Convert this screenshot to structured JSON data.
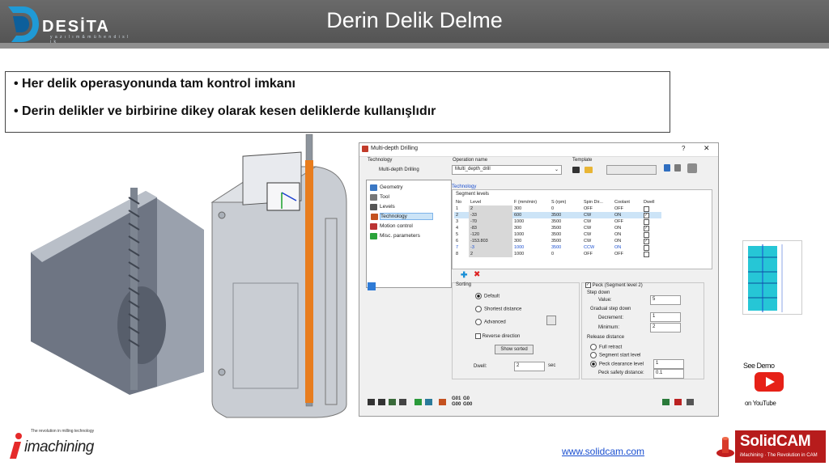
{
  "header": {
    "title": "Derin Delik Delme",
    "logo_name": "DESİTA",
    "logo_tagline": "y a z ı l ı m   &   m ü h e n d i s l i k"
  },
  "bullets": [
    "Her delik operasyonunda tam kontrol imkanı",
    "Derin delikler ve birbirine dikey olarak kesen deliklerde kullanışlıdır"
  ],
  "dialog": {
    "title": "Multi-depth Drilling",
    "technology_label": "Technology",
    "technology_value": "Multi-depth Drilling",
    "operation_name_label": "Operation name",
    "operation_name_value": "Multi_depth_drill",
    "template_label": "Template",
    "tab_label": "Technology",
    "tree_items": [
      "Geometry",
      "Tool",
      "Levels",
      "Technology",
      "Motion control",
      "Misc. parameters"
    ],
    "segment_levels_label": "Segment levels",
    "columns": [
      "No",
      "Level",
      "F (mm/min)",
      "S (rpm)",
      "Spin Dir...",
      "Coolant",
      "Dwell"
    ],
    "rows": [
      {
        "no": "1",
        "level": "2",
        "f": "300",
        "s": "0",
        "spin": "OFF",
        "coolant": "OFF",
        "dwell": false
      },
      {
        "no": "2",
        "level": "-33",
        "f": "600",
        "s": "3500",
        "spin": "CW",
        "coolant": "ON",
        "dwell": true
      },
      {
        "no": "3",
        "level": "-70",
        "f": "1000",
        "s": "3500",
        "spin": "CW",
        "coolant": "OFF",
        "dwell": false
      },
      {
        "no": "4",
        "level": "-83",
        "f": "300",
        "s": "3500",
        "spin": "CW",
        "coolant": "ON",
        "dwell": true
      },
      {
        "no": "5",
        "level": "-120",
        "f": "1000",
        "s": "3500",
        "spin": "CW",
        "coolant": "ON",
        "dwell": false
      },
      {
        "no": "6",
        "level": "-153.803",
        "f": "300",
        "s": "3500",
        "spin": "CW",
        "coolant": "ON",
        "dwell": true
      },
      {
        "no": "7",
        "level": "-3",
        "f": "1000",
        "s": "3500",
        "spin": "CCW",
        "coolant": "ON",
        "dwell": false
      },
      {
        "no": "8",
        "level": "2",
        "f": "1000",
        "s": "0",
        "spin": "OFF",
        "coolant": "OFF",
        "dwell": false
      }
    ],
    "sorting_label": "Sorting",
    "sorting_options": [
      "Default",
      "Shortest distance",
      "Advanced"
    ],
    "reverse_direction_label": "Reverse direction",
    "show_sorted_label": "Show sorted",
    "dwell_label": "Dwell:",
    "dwell_value": "2",
    "dwell_unit": "sec",
    "peck_label": "Peck",
    "peck_segment": "(Segment level 2)",
    "step_down_label": "Step down",
    "value_label": "Value:",
    "value_value": "5",
    "gradual_label": "Gradual step down",
    "decrement_label": "Decrement:",
    "decrement_value": "1",
    "minimum_label": "Minimum:",
    "minimum_value": "2",
    "release_label": "Release distance",
    "release_options": [
      "Full retract",
      "Segment start level",
      "Peck clearance level"
    ],
    "peck_clearance_value": "1",
    "peck_safety_label": "Peck safety distance:",
    "peck_safety_value": "0.1",
    "gcode_a": "G01",
    "gcode_b": "G00",
    "gcode_c": "G0",
    "gcode_d": "G00"
  },
  "footer": {
    "url": "www.solidcam.com",
    "see_demo": "See Demo",
    "on_youtube": "on YouTube",
    "imachining_tagline": "The revolution in milling technology",
    "imachining_name": "imachining",
    "solidcam_name": "SolidCAM",
    "solidcam_tagline": "iMachining · The Revolution in CAM"
  },
  "colors": {
    "header": "#5f5f5f",
    "accent_orange": "#e87d1e",
    "youtube_red": "#e62117",
    "link_blue": "#1a4fd0",
    "selection_blue": "#cce4f7"
  }
}
